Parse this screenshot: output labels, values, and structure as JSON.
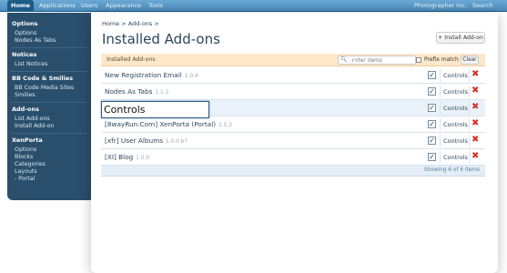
{
  "nav": {
    "tabs": [
      "Home",
      "Applications",
      "Users",
      "Appearance",
      "Tools"
    ],
    "site_name": "Photographer Inc.",
    "search_label": "Search"
  },
  "sidebar": {
    "groups": [
      {
        "heading": "Options",
        "items": [
          "Options",
          "Nodes As Tabs"
        ]
      },
      {
        "heading": "Notices",
        "items": [
          "List Notices"
        ]
      },
      {
        "heading": "BB Code & Smilies",
        "items": [
          "BB Code Media Sites",
          "Smilies"
        ]
      },
      {
        "heading": "Add-ons",
        "items": [
          "List Add-ons",
          "Install Add-on"
        ]
      },
      {
        "heading": "XenPorta",
        "items": [
          "Options",
          "Blocks",
          "Categories",
          "Layouts",
          "- Portal"
        ]
      }
    ]
  },
  "main": {
    "breadcrumb": "Home >  Add-ons >",
    "title": "Installed Add-ons",
    "install_button": "+ Install Add-on",
    "list_header": "Installed Add-ons",
    "filter": {
      "placeholder": "Filter items",
      "value": ""
    },
    "prefix_match": "Prefix match",
    "clear_button": "Clear",
    "controls_label": "Controls",
    "rows": [
      {
        "name": "New Registration Email",
        "version": "1.0.4",
        "enabled": true
      },
      {
        "name": "Nodes As Tabs",
        "version": "1.1.3",
        "enabled": true
      },
      {
        "name": "",
        "version": "",
        "enabled": true
      },
      {
        "name": "[8wayRun.Com] XenPorta (Portal)",
        "version": "1.5.3",
        "enabled": true
      },
      {
        "name": "[xfr] User Albums",
        "version": "1.0.0 b7",
        "enabled": true
      },
      {
        "name": "[XI] Blog",
        "version": "1.0.0",
        "enabled": true
      }
    ],
    "tooltip": "Controls",
    "showing": "Showing 6 of 6 items"
  },
  "colors": {
    "nav_bar": "#5a9acb",
    "sidebar": "#2a4f6c",
    "list_header": "#fde8c9",
    "delete_icon": "#d7322a"
  }
}
